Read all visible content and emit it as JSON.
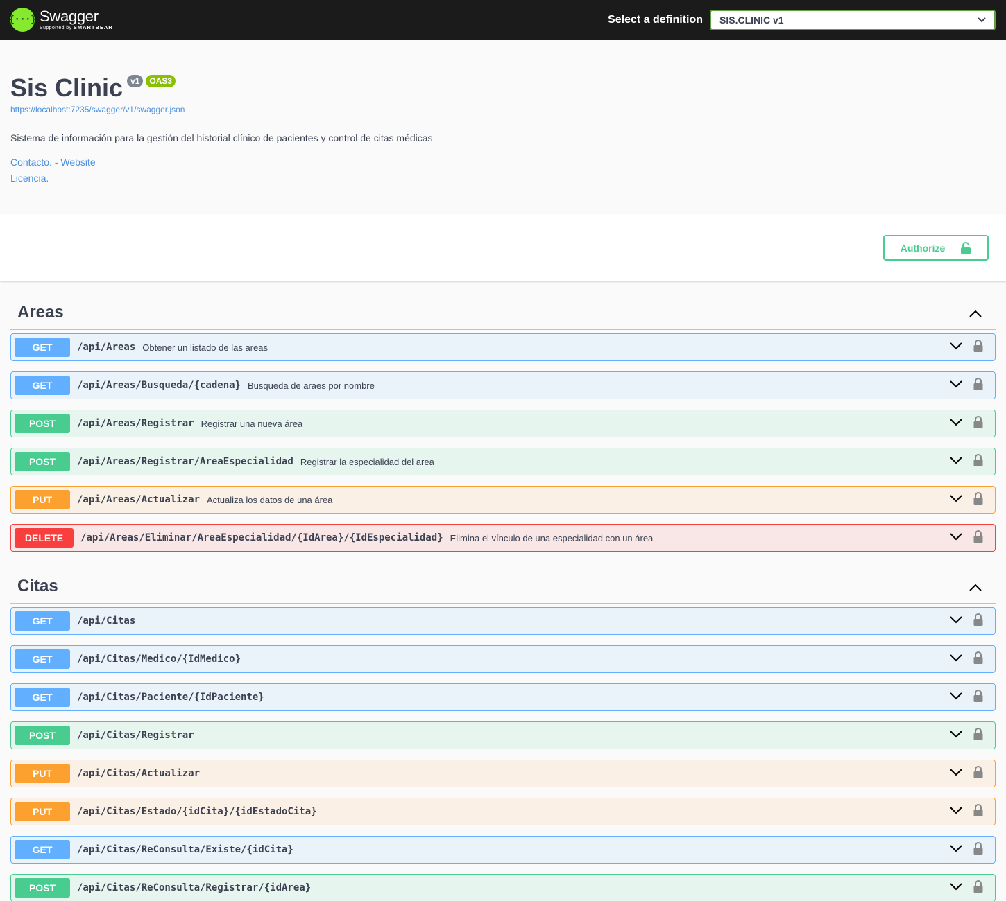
{
  "topbar": {
    "logo_glyph": "{···}",
    "logo_title": "Swagger",
    "logo_supported": "Supported by",
    "logo_brand": "SMARTBEAR",
    "select_label": "Select a definition",
    "select_value": "SIS.CLINIC v1"
  },
  "info": {
    "title": "Sis Clinic",
    "version_badge": "v1",
    "oas_badge": "OAS3",
    "spec_url": "https://localhost:7235/swagger/v1/swagger.json",
    "description": "Sistema de información para la gestión del historial clínico de pacientes y control de citas médicas",
    "contact_link": "Contacto. - Website",
    "license_link": "Licencia."
  },
  "authorize_label": "Authorize",
  "colors": {
    "get": "#61affe",
    "post": "#49cc90",
    "put": "#fca130",
    "delete": "#f93e3e",
    "brand": "#85ea2d"
  },
  "tags": [
    {
      "name": "Areas",
      "operations": [
        {
          "method": "GET",
          "path": "/api/Areas",
          "summary": "Obtener un listado de las areas"
        },
        {
          "method": "GET",
          "path": "/api/Areas/Busqueda/{cadena}",
          "summary": "Busqueda de araes por nombre"
        },
        {
          "method": "POST",
          "path": "/api/Areas/Registrar",
          "summary": "Registrar una nueva área"
        },
        {
          "method": "POST",
          "path": "/api/Areas/Registrar/AreaEspecialidad",
          "summary": "Registrar la especialidad del area"
        },
        {
          "method": "PUT",
          "path": "/api/Areas/Actualizar",
          "summary": "Actualiza los datos de una área"
        },
        {
          "method": "DELETE",
          "path": "/api/Areas/Eliminar/AreaEspecialidad/{IdArea}/{IdEspecialidad}",
          "summary": "Elimina el vínculo de una especialidad con un área"
        }
      ]
    },
    {
      "name": "Citas",
      "operations": [
        {
          "method": "GET",
          "path": "/api/Citas",
          "summary": ""
        },
        {
          "method": "GET",
          "path": "/api/Citas/Medico/{IdMedico}",
          "summary": ""
        },
        {
          "method": "GET",
          "path": "/api/Citas/Paciente/{IdPaciente}",
          "summary": ""
        },
        {
          "method": "POST",
          "path": "/api/Citas/Registrar",
          "summary": ""
        },
        {
          "method": "PUT",
          "path": "/api/Citas/Actualizar",
          "summary": ""
        },
        {
          "method": "PUT",
          "path": "/api/Citas/Estado/{idCita}/{idEstadoCita}",
          "summary": ""
        },
        {
          "method": "GET",
          "path": "/api/Citas/ReConsulta/Existe/{idCita}",
          "summary": ""
        },
        {
          "method": "POST",
          "path": "/api/Citas/ReConsulta/Registrar/{idArea}",
          "summary": ""
        }
      ]
    }
  ]
}
